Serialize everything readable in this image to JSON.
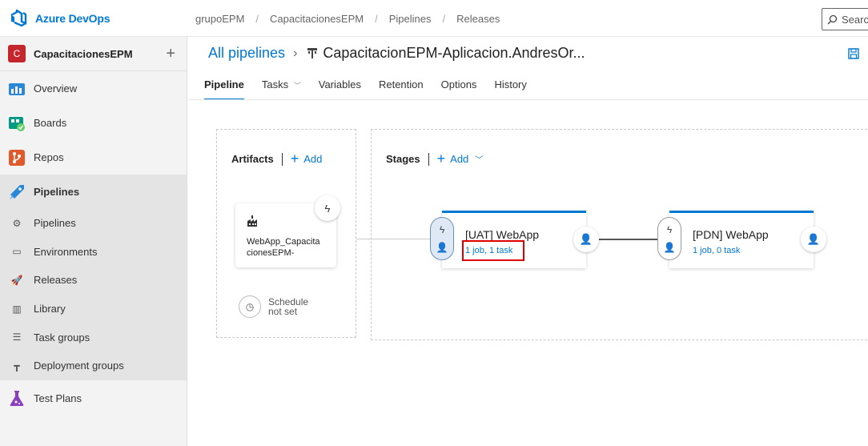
{
  "app": {
    "name": "Azure DevOps"
  },
  "breadcrumbs": [
    "grupoEPM",
    "CapacitacionesEPM",
    "Pipelines",
    "Releases"
  ],
  "search": {
    "placeholder": "Searc"
  },
  "project": {
    "badge": "C",
    "name": "CapacitacionesEPM"
  },
  "nav": [
    {
      "label": "Overview",
      "icon": "overview-icon"
    },
    {
      "label": "Boards",
      "icon": "boards-icon"
    },
    {
      "label": "Repos",
      "icon": "repos-icon"
    },
    {
      "label": "Pipelines",
      "icon": "pipelines-icon"
    }
  ],
  "pipelines_sub": [
    {
      "label": "Pipelines",
      "icon": "pipelines-sub-icon"
    },
    {
      "label": "Environments",
      "icon": "environments-icon"
    },
    {
      "label": "Releases",
      "icon": "releases-icon"
    },
    {
      "label": "Library",
      "icon": "library-icon"
    },
    {
      "label": "Task groups",
      "icon": "task-groups-icon"
    },
    {
      "label": "Deployment groups",
      "icon": "deployment-groups-icon"
    }
  ],
  "test_plans": {
    "label": "Test Plans",
    "icon": "test-plans-icon"
  },
  "header": {
    "all_pipelines": "All pipelines",
    "pipeline_name": "CapacitacionEPM-Aplicacion.AndresOr..."
  },
  "tabs": [
    "Pipeline",
    "Tasks",
    "Variables",
    "Retention",
    "Options",
    "History"
  ],
  "artifacts": {
    "title": "Artifacts",
    "add": "Add",
    "artifact_name_line1": "WebApp_Capacita",
    "artifact_name_line2": "cionesEPM-",
    "schedule_line1": "Schedule",
    "schedule_line2": "not set"
  },
  "stages": {
    "title": "Stages",
    "add": "Add",
    "items": [
      {
        "name": "[UAT] WebApp",
        "summary": "1 job, 1 task"
      },
      {
        "name": "[PDN] WebApp",
        "summary": "1 job, 0 task"
      }
    ]
  },
  "colors": {
    "accent": "#0078d4",
    "highlight": "#e00000",
    "project_badge": "#c4262e"
  }
}
